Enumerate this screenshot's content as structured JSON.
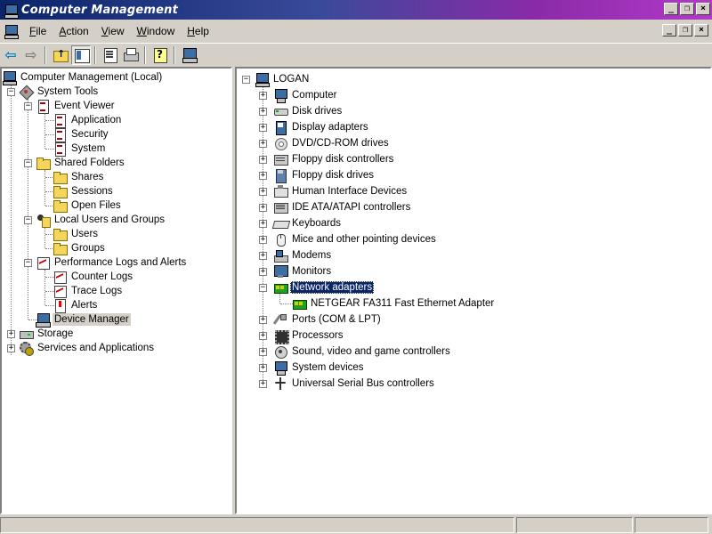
{
  "window": {
    "title": "Computer Management",
    "buttons": {
      "minimize": "_",
      "restore": "❐",
      "close": "×"
    }
  },
  "menubar": {
    "items": [
      {
        "underline": "F",
        "rest": "ile"
      },
      {
        "underline": "A",
        "rest": "ction"
      },
      {
        "underline": "V",
        "rest": "iew"
      },
      {
        "underline": "W",
        "rest": "indow"
      },
      {
        "underline": "H",
        "rest": "elp"
      }
    ]
  },
  "toolbar": {
    "icons": [
      "back-icon",
      "forward-icon",
      "up-one-level-icon",
      "show-hide-tree-icon",
      "properties-icon",
      "print-icon",
      "help-icon",
      "device-manager-icon"
    ]
  },
  "left_tree": {
    "root": "Computer Management (Local)",
    "system_tools": "System Tools",
    "event_viewer": "Event Viewer",
    "application": "Application",
    "security": "Security",
    "system": "System",
    "shared_folders": "Shared Folders",
    "shares": "Shares",
    "sessions": "Sessions",
    "open_files": "Open Files",
    "local_users": "Local Users and Groups",
    "users": "Users",
    "groups": "Groups",
    "perf_logs": "Performance Logs and Alerts",
    "counter_logs": "Counter Logs",
    "trace_logs": "Trace Logs",
    "alerts": "Alerts",
    "device_manager": "Device Manager",
    "storage": "Storage",
    "services": "Services and Applications"
  },
  "device_tree": {
    "root": "LOGAN",
    "items": [
      "Computer",
      "Disk drives",
      "Display adapters",
      "DVD/CD-ROM drives",
      "Floppy disk controllers",
      "Floppy disk drives",
      "Human Interface Devices",
      "IDE ATA/ATAPI controllers",
      "Keyboards",
      "Mice and other pointing devices",
      "Modems",
      "Monitors",
      "Network adapters",
      "NETGEAR FA311 Fast Ethernet Adapter",
      "Ports (COM & LPT)",
      "Processors",
      "Sound, video and game controllers",
      "System devices",
      "Universal Serial Bus controllers"
    ]
  },
  "colors": {
    "title_gradient_start": "#0a246a",
    "title_gradient_end": "#b23ac8",
    "selection": "#0a246a",
    "window_face": "#d4d0c8"
  }
}
